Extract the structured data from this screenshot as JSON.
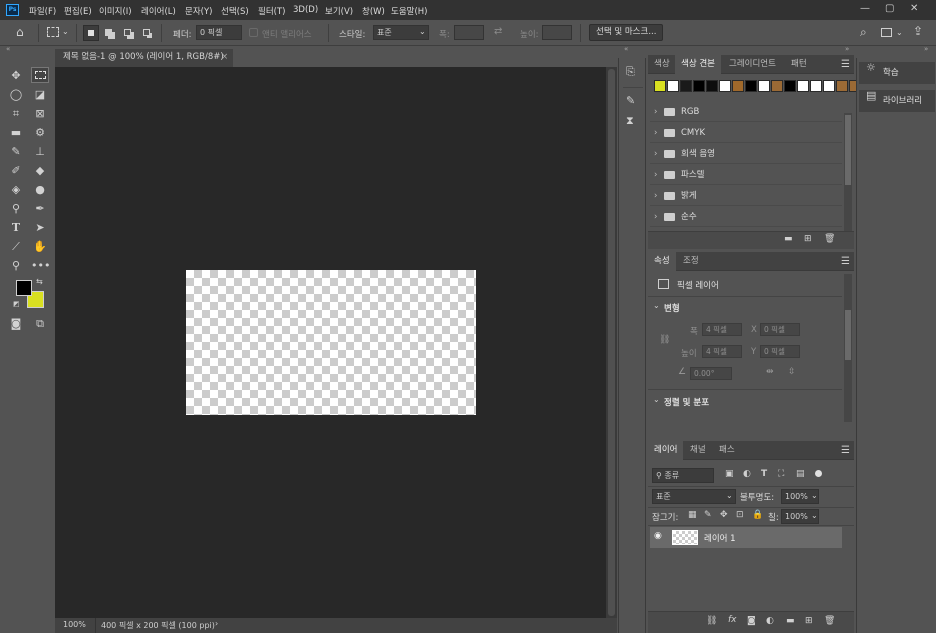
{
  "app": {
    "logo_text": "Ps",
    "menu": [
      "파일(F)",
      "편집(E)",
      "이미지(I)",
      "레이어(L)",
      "문자(Y)",
      "선택(S)",
      "필터(T)",
      "3D(D)",
      "보기(V)",
      "창(W)",
      "도움말(H)"
    ],
    "window_controls": [
      "—",
      "▢",
      "✕"
    ]
  },
  "options": {
    "feather_label": "페더:",
    "feather_value": "0 픽셀",
    "antialias_label": "앤티 앨리어스",
    "style_label": "스타일:",
    "style_value": "표준",
    "width_label": "폭:",
    "height_label": "높이:",
    "select_mask_button": "선택 및 마스크..."
  },
  "document": {
    "tab_title": "제목 없음-1 @ 100% (레이어 1, RGB/8#)",
    "tab_close": "×",
    "zoom": "100%",
    "doc_info": "400 픽셀 x 200 픽셀 (100 ppi)",
    "status_arrow": "›"
  },
  "swatches_panel": {
    "tabs": [
      "색상",
      "색상 견본",
      "그레이디언트",
      "패턴"
    ],
    "active_tab": 1,
    "colors": [
      "#d9e021",
      "#ffffff",
      "#1a1a1a",
      "#000000",
      "#0d0d0d",
      "#ffffff",
      "#a0692b",
      "#000000",
      "#ffffff",
      "#9b6a35",
      "#000000",
      "#ffffff",
      "#ffffff",
      "#ffffff",
      "#9b6a35",
      "#9b6a35"
    ],
    "groups": [
      "RGB",
      "CMYK",
      "회색 음영",
      "파스텔",
      "밝게",
      "순수"
    ]
  },
  "properties_panel": {
    "tabs": [
      "속성",
      "조정"
    ],
    "active_tab": 0,
    "layer_type": "픽셀 레이어",
    "transform_header": "변형",
    "w_label": "폭",
    "w_value": "4 픽셀",
    "x_label": "X",
    "x_value": "0 픽셀",
    "h_label": "높이",
    "h_value": "4 픽셀",
    "y_label": "Y",
    "y_value": "0 픽셀",
    "angle_value": "0.00°",
    "align_header": "정렬 및 분포"
  },
  "layers_panel": {
    "tabs": [
      "레이어",
      "채널",
      "패스"
    ],
    "active_tab": 0,
    "filter_kind": "종류",
    "blend_mode": "표준",
    "opacity_label": "불투명도:",
    "opacity_value": "100%",
    "lock_label": "잠그기:",
    "fill_label": "칠:",
    "fill_value": "100%",
    "layers": [
      {
        "name": "레이어 1",
        "visible": true
      }
    ]
  },
  "right_panels": {
    "learn": "학습",
    "libraries": "라이브러리"
  }
}
